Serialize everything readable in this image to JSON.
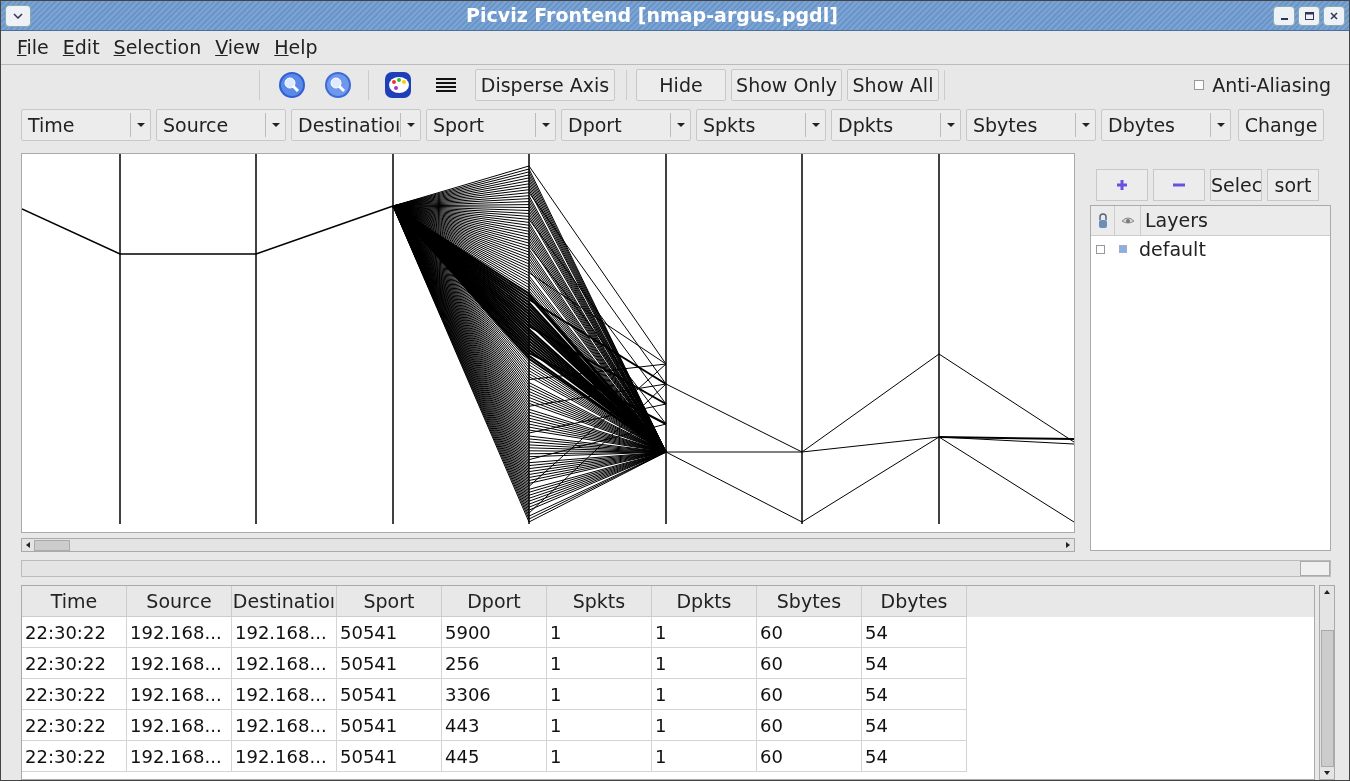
{
  "window": {
    "title": "Picviz Frontend [nmap-argus.pgdl]"
  },
  "menu": [
    "File",
    "Edit",
    "Selection",
    "View",
    "Help"
  ],
  "toolbar": {
    "buttons": [
      "Disperse Axis",
      "Hide",
      "Show Only",
      "Show All"
    ],
    "anti_aliasing": {
      "label": "Anti-Aliasing",
      "checked": false
    }
  },
  "axes": [
    "Time",
    "Source",
    "Destinatioı",
    "Sport",
    "Dport",
    "Spkts",
    "Dpkts",
    "Sbytes",
    "Dbytes"
  ],
  "change_button": "Change",
  "layers_panel": {
    "buttons": [
      "Selec",
      "sort"
    ],
    "header": "Layers",
    "layers": [
      {
        "name": "default",
        "checked": false
      }
    ]
  },
  "table": {
    "columns": [
      "Time",
      "Source",
      "Destinatioı",
      "Sport",
      "Dport",
      "Spkts",
      "Dpkts",
      "Sbytes",
      "Dbytes"
    ],
    "rows": [
      [
        "22:30:22",
        "192.168...",
        "192.168...",
        "50541",
        "5900",
        "1",
        "1",
        "60",
        "54"
      ],
      [
        "22:30:22",
        "192.168...",
        "192.168...",
        "50541",
        "256",
        "1",
        "1",
        "60",
        "54"
      ],
      [
        "22:30:22",
        "192.168...",
        "192.168...",
        "50541",
        "3306",
        "1",
        "1",
        "60",
        "54"
      ],
      [
        "22:30:22",
        "192.168...",
        "192.168...",
        "50541",
        "443",
        "1",
        "1",
        "60",
        "54"
      ],
      [
        "22:30:22",
        "192.168...",
        "192.168...",
        "50541",
        "445",
        "1",
        "1",
        "60",
        "54"
      ]
    ]
  }
}
